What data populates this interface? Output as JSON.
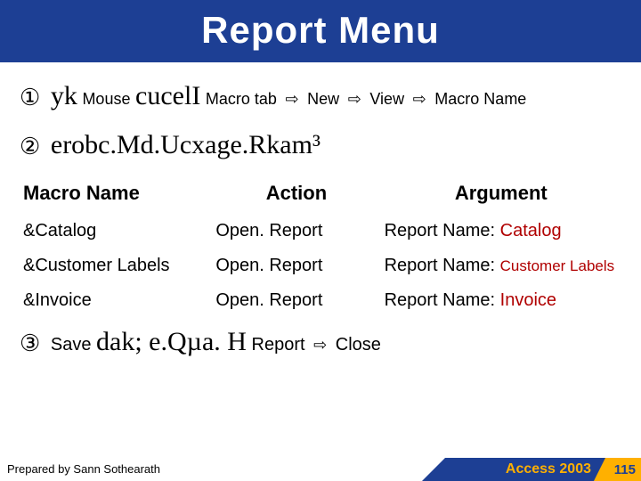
{
  "title": "Report Menu",
  "step1": {
    "num": "①",
    "partA": "yk",
    "partB": "Mouse",
    "partC": "cucelI",
    "partD": "Macro tab",
    "seq": [
      "New",
      "View",
      "Macro Name"
    ]
  },
  "step2": {
    "num": "②",
    "text": "erobc.Md.Ucxage.Rkam³"
  },
  "table": {
    "headers": [
      "Macro Name",
      "Action",
      "Argument"
    ],
    "rows": [
      {
        "name": "&Catalog",
        "action": "Open. Report",
        "arg_label": "Report Name:",
        "arg_value": "Catalog",
        "small": false
      },
      {
        "name": "&Customer Labels",
        "action": "Open. Report",
        "arg_label": "Report Name:",
        "arg_value": "Customer Labels",
        "small": true
      },
      {
        "name": "&Invoice",
        "action": "Open. Report",
        "arg_label": "Report Name:",
        "arg_value": "Invoice",
        "small": false
      }
    ]
  },
  "step3": {
    "num": "③",
    "save": "Save",
    "mid": "dak; e.Qµa. H",
    "report": "Report",
    "close": "Close"
  },
  "footer": {
    "prepared": "Prepared by Sann Sothearath",
    "app": "Access 2003",
    "page": "115"
  },
  "glyphs": {
    "arrow": "⇨"
  }
}
